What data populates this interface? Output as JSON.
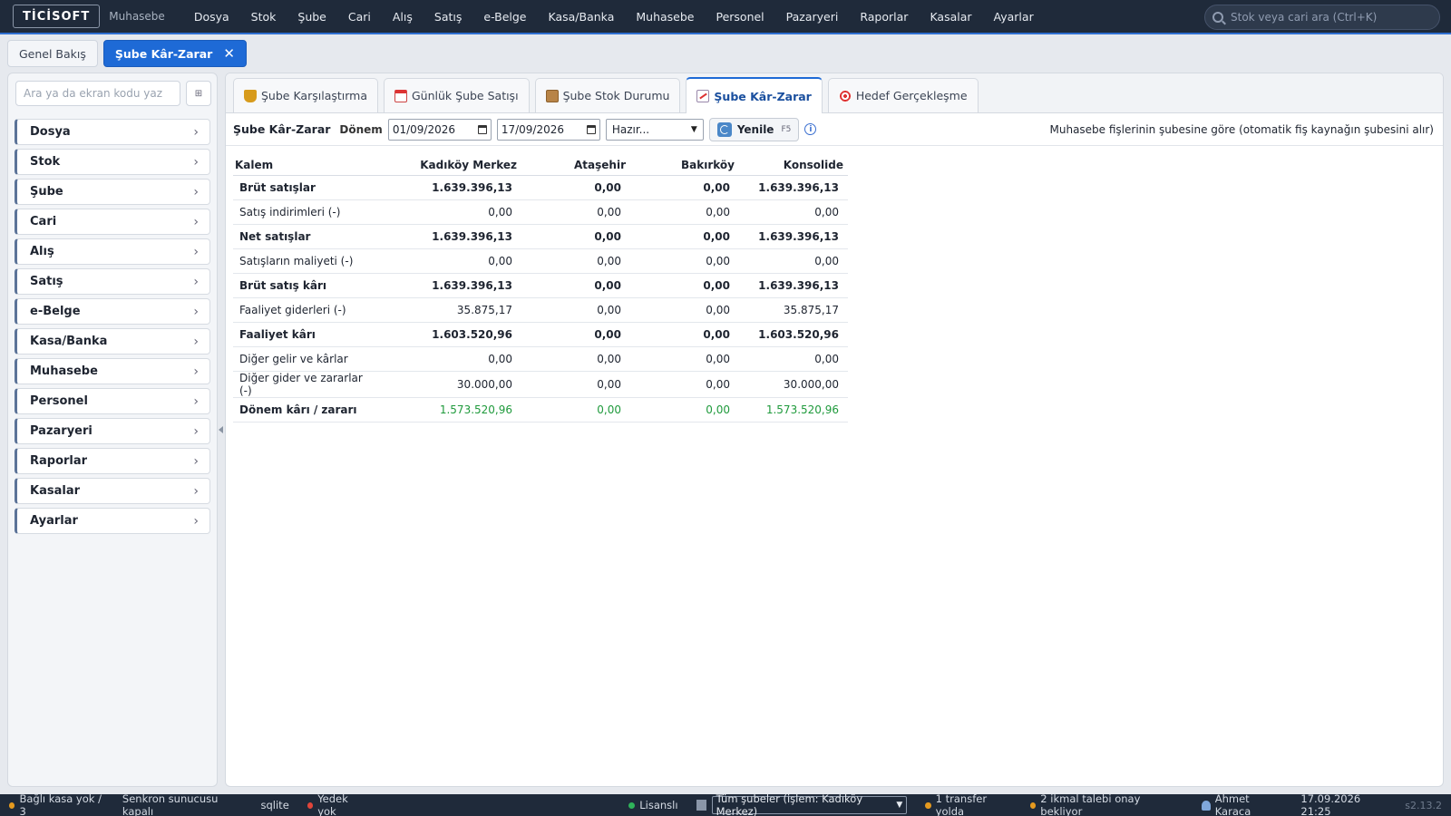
{
  "topbar": {
    "logo": "TİCİSOFT",
    "subtitle": "Muhasebe",
    "menu": [
      "Dosya",
      "Stok",
      "Şube",
      "Cari",
      "Alış",
      "Satış",
      "e-Belge",
      "Kasa/Banka",
      "Muhasebe",
      "Personel",
      "Pazaryeri",
      "Raporlar",
      "Kasalar",
      "Ayarlar"
    ],
    "search_placeholder": "Stok veya cari ara (Ctrl+K)"
  },
  "doctabs": [
    {
      "label": "Genel Bakış",
      "active": false
    },
    {
      "label": "Şube Kâr-Zarar",
      "active": true,
      "close": "✕"
    }
  ],
  "sidebar": {
    "search_placeholder": "Ara ya da ekran kodu yaz",
    "grid_btn": "⊞",
    "items": [
      "Dosya",
      "Stok",
      "Şube",
      "Cari",
      "Alış",
      "Satış",
      "e-Belge",
      "Kasa/Banka",
      "Muhasebe",
      "Personel",
      "Pazaryeri",
      "Raporlar",
      "Kasalar",
      "Ayarlar"
    ]
  },
  "subtabs": [
    {
      "label": "Şube Karşılaştırma",
      "icon": "trophy-icon",
      "active": false
    },
    {
      "label": "Günlük Şube Satışı",
      "icon": "calendar-icon",
      "active": false
    },
    {
      "label": "Şube Stok Durumu",
      "icon": "box-icon",
      "active": false
    },
    {
      "label": "Şube Kâr-Zarar",
      "icon": "chart-icon",
      "active": true
    },
    {
      "label": "Hedef Gerçekleşme",
      "icon": "target-icon",
      "active": false
    }
  ],
  "toolbar": {
    "title": "Şube Kâr-Zarar",
    "period_label": "Dönem",
    "date_from": "01/09/2026",
    "date_to": "17/09/2026",
    "preset": "Hazır...",
    "refresh_label": "Yenile",
    "refresh_key": "F5",
    "info": "i",
    "note": "Muhasebe fişlerinin şubesine göre (otomatik fiş kaynağın şubesini alır)"
  },
  "table": {
    "headers": [
      "Kalem",
      "Kadıköy Merkez",
      "Ataşehir",
      "Bakırköy",
      "Konsolide"
    ],
    "rows": [
      {
        "label": "Brüt satışlar",
        "values": [
          "1.639.396,13",
          "0,00",
          "0,00",
          "1.639.396,13"
        ],
        "style": "bold"
      },
      {
        "label": "Satış indirimleri (-)",
        "values": [
          "0,00",
          "0,00",
          "0,00",
          "0,00"
        ],
        "style": "normal"
      },
      {
        "label": "Net satışlar",
        "values": [
          "1.639.396,13",
          "0,00",
          "0,00",
          "1.639.396,13"
        ],
        "style": "bold"
      },
      {
        "label": "Satışların maliyeti (-)",
        "values": [
          "0,00",
          "0,00",
          "0,00",
          "0,00"
        ],
        "style": "normal"
      },
      {
        "label": "Brüt satış kârı",
        "values": [
          "1.639.396,13",
          "0,00",
          "0,00",
          "1.639.396,13"
        ],
        "style": "bold"
      },
      {
        "label": "Faaliyet giderleri (-)",
        "values": [
          "35.875,17",
          "0,00",
          "0,00",
          "35.875,17"
        ],
        "style": "normal"
      },
      {
        "label": "Faaliyet kârı",
        "values": [
          "1.603.520,96",
          "0,00",
          "0,00",
          "1.603.520,96"
        ],
        "style": "bold"
      },
      {
        "label": "Diğer gelir ve kârlar",
        "values": [
          "0,00",
          "0,00",
          "0,00",
          "0,00"
        ],
        "style": "normal"
      },
      {
        "label": "Diğer gider ve zararlar (-)",
        "values": [
          "30.000,00",
          "0,00",
          "0,00",
          "30.000,00"
        ],
        "style": "normal"
      },
      {
        "label": "Dönem kârı / zararı",
        "values": [
          "1.573.520,96",
          "0,00",
          "0,00",
          "1.573.520,96"
        ],
        "style": "green"
      }
    ]
  },
  "statusbar": {
    "cash": "Bağlı kasa yok / 3",
    "sync": "Senkron sunucusu kapalı",
    "db": "sqlite",
    "backup": "Yedek yok",
    "license": "Lisanslı",
    "branch_select": "Tüm şubeler (işlem: Kadıköy Merkez)",
    "transfer": "1 transfer yolda",
    "requests": "2 ikmal talebi onay bekliyor",
    "user": "Ahmet Karaca",
    "datetime": "17.09.2026 21:25",
    "version": "s2.13.2"
  },
  "colors": {
    "accent": "#1e6ad6",
    "topbar": "#1f2a3a",
    "profit_green": "#1f9a3c",
    "status_green": "#2fb35a",
    "status_red": "#e0453a",
    "status_orange": "#e59a1f"
  }
}
